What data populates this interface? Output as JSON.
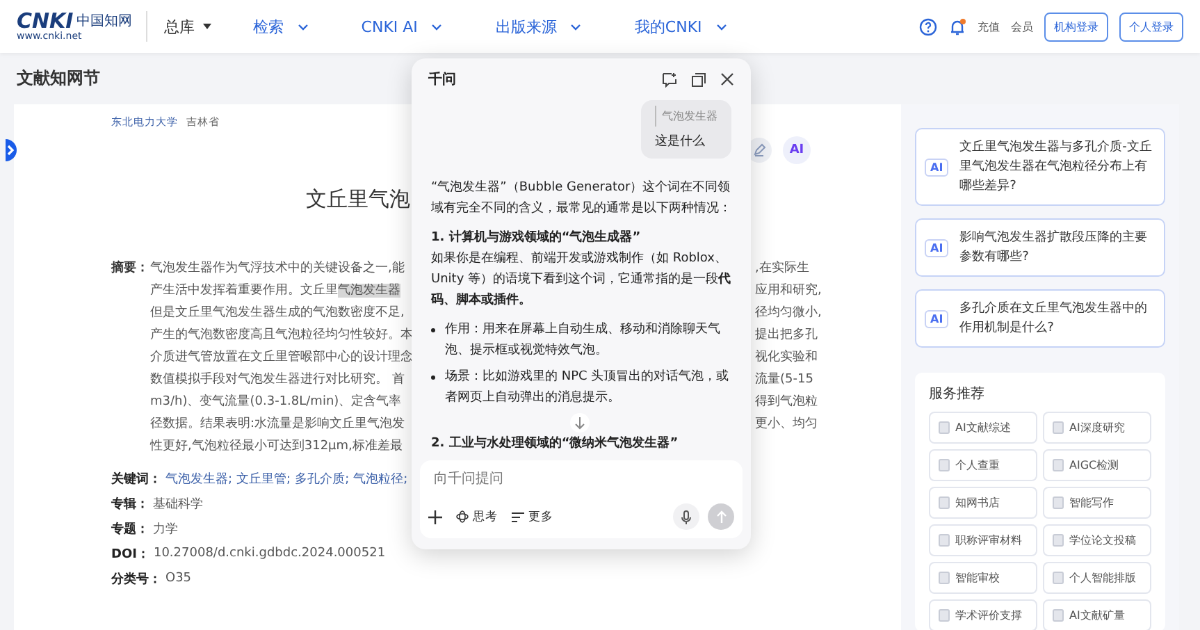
{
  "header": {
    "logo": {
      "mark": "CNKI",
      "name": "中国知网",
      "url": "www.cnki.net"
    },
    "scope": "总库",
    "nav": [
      {
        "label": "检索"
      },
      {
        "label": "CNKI AI"
      },
      {
        "label": "出版来源"
      },
      {
        "label": "我的CNKI"
      }
    ],
    "links": [
      "充值",
      "会员"
    ],
    "buttons": [
      "机构登录",
      "个人登录"
    ]
  },
  "page_title": "文献知网节",
  "article": {
    "affiliation": [
      "东北电力大学",
      "吉林省"
    ],
    "ai_button": "AI",
    "title": "文丘里气泡",
    "abstract": {
      "label": "摘要：",
      "lines": [
        {
          "left": "气泡发生器作为气浮技术中的关键设备之一,能",
          "right": ",在实际生"
        },
        {
          "left": "产生活中发挥着重要作用。文丘里",
          "highlight": "气泡发生器",
          "right": "应用和研究,"
        },
        {
          "left": "但是文丘里气泡发生器生成的气泡数密度不足,",
          "right": "径均匀微小,"
        },
        {
          "left": "产生的气泡数密度高且气泡粒径均匀性较好。本",
          "right": "提出把多孔"
        },
        {
          "left": "介质进气管放置在文丘里管喉部中心的设计理念",
          "right": "视化实验和"
        },
        {
          "left": "数值模拟手段对气泡发生器进行对比研究。 首",
          "right": "流量(5-15"
        },
        {
          "left": "m3/h)、变气流量(0.3-1.8L/min)、定含气率",
          "right": "得到气泡粒"
        },
        {
          "left": "径数据。结果表明:水流量是影响文丘里气泡发",
          "right": "更小、均匀"
        },
        {
          "left": "性更好,气泡粒径最小可达到312μm,标准差最"
        }
      ]
    },
    "fields": [
      {
        "label": "关键词：",
        "kind": "links",
        "values": [
          "气泡发生器;",
          "文丘里管;",
          "多孔介质;",
          "气泡粒径;"
        ]
      },
      {
        "label": "专辑：",
        "kind": "text",
        "value": "基础科学"
      },
      {
        "label": "专题：",
        "kind": "text",
        "value": "力学"
      },
      {
        "label": "DOI：",
        "kind": "text",
        "value": "10.27008/d.cnki.gdbdc.2024.000521"
      },
      {
        "label": "分类号：",
        "kind": "text",
        "value": "O35"
      }
    ]
  },
  "chat": {
    "title": "千问",
    "user_message": {
      "quote": "气泡发生器",
      "text": "这是什么"
    },
    "answer": [
      {
        "kind": "paragraph",
        "text": "“气泡发生器”（Bubble Generator）这个词在不同领域有完全不同的含义，最常见的通常是以下两种情况："
      },
      {
        "kind": "heading",
        "text": "1. 计算机与游戏领域的“气泡生成器”"
      },
      {
        "kind": "paragraph",
        "text": "如果你是在编程、前端开发或游戏制作（如 Roblox、Unity 等）的语境下看到这个词，它通常指的是一段**代码、脚本或插件。**"
      },
      {
        "kind": "bullet",
        "text": "作用：用来在屏幕上自动生成、移动和消除聊天气泡、提示框或视觉特效气泡。"
      },
      {
        "kind": "bullet",
        "text": "场景：比如游戏里的 NPC 头顶冒出的对话气泡，或者网页上自动弹出的消息提示。"
      },
      {
        "kind": "heading",
        "text": "2. 工业与水处理领域的“微纳米气泡发生器”"
      }
    ],
    "input": {
      "placeholder": "向千问提问"
    },
    "tools": [
      "思考",
      "更多"
    ]
  },
  "sidebar": {
    "questions": [
      {
        "badge": "AI",
        "text": "文丘里气泡发生器与多孔介质-文丘里气泡发生器在气泡粒径分布上有哪些差异?"
      },
      {
        "badge": "AI",
        "text": "影响气泡发生器扩散段压降的主要参数有哪些?"
      },
      {
        "badge": "AI",
        "text": "多孔介质在文丘里气泡发生器中的作用机制是什么?"
      }
    ],
    "services": {
      "title": "服务推荐",
      "items": [
        "AI文献综述",
        "AI深度研究",
        "个人查重",
        "AIGC检测",
        "知网书店",
        "智能写作",
        "职称评审材料",
        "学位论文投稿",
        "智能审校",
        "个人智能排版",
        "学术评价支撑",
        "AI文献矿量"
      ]
    }
  }
}
